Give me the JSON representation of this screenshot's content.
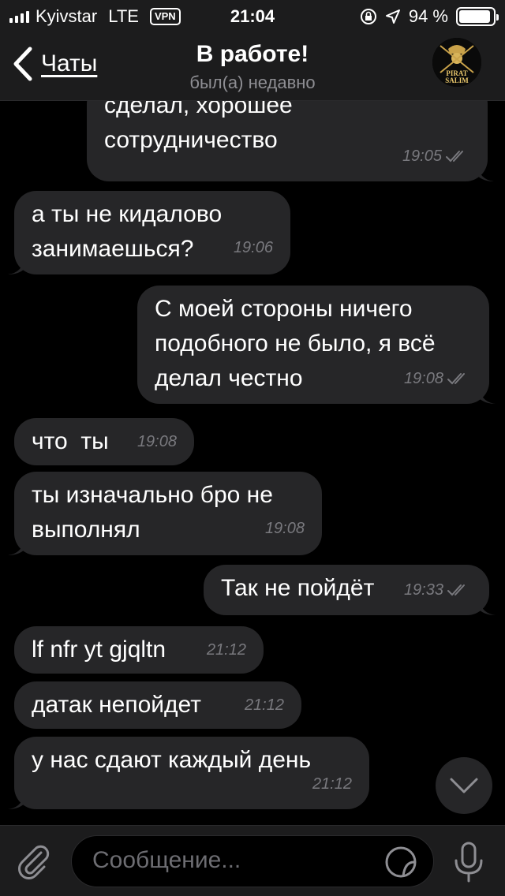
{
  "status_bar": {
    "carrier": "Kyivstar",
    "network": "LTE",
    "vpn": "VPN",
    "time": "21:04",
    "battery": "94 %",
    "battery_level": 0.94
  },
  "header": {
    "back_label": "Чаты",
    "title": "В работе!",
    "subtitle": "был(а) недавно",
    "avatar_text_1": "PIRAT",
    "avatar_text_2": "SALIM"
  },
  "messages": [
    {
      "dir": "out",
      "text_lines": [
        "сделал, хорошее",
        "сотрудничество"
      ],
      "time": "19:05",
      "read": true
    },
    {
      "dir": "in",
      "text_lines": [
        "а ты не кидалово",
        "занимаешься?"
      ],
      "time": "19:06"
    },
    {
      "dir": "out",
      "text_lines": [
        "С моей стороны ничего",
        "подобного не было, я всё",
        "делал честно"
      ],
      "time": "19:08",
      "read": true
    },
    {
      "dir": "in",
      "text_lines": [
        "что  ты"
      ],
      "time": "19:08"
    },
    {
      "dir": "in",
      "text_lines": [
        "ты изначально бро не",
        "выполнял"
      ],
      "time": "19:08"
    },
    {
      "dir": "out",
      "text_lines": [
        "Так не пойдёт"
      ],
      "time": "19:33",
      "read": true
    },
    {
      "dir": "in",
      "text_lines": [
        "lf nfr yt gjqltn"
      ],
      "time": "21:12"
    },
    {
      "dir": "in",
      "text_lines": [
        "датак непойдет"
      ],
      "time": "21:12"
    },
    {
      "dir": "in",
      "text_lines": [
        "у нас сдают каждый день"
      ],
      "time": "21:12"
    }
  ],
  "input": {
    "placeholder": "Сообщение..."
  },
  "icons": {
    "back": "chevron-left-icon",
    "attach": "paperclip-icon",
    "sticker": "sticker-icon",
    "mic": "microphone-icon",
    "scroll": "chevron-down-icon",
    "read": "double-check-icon"
  },
  "colors": {
    "background": "#000000",
    "bubble": "#262628",
    "bar": "#1c1c1d",
    "meta": "#79797e"
  }
}
